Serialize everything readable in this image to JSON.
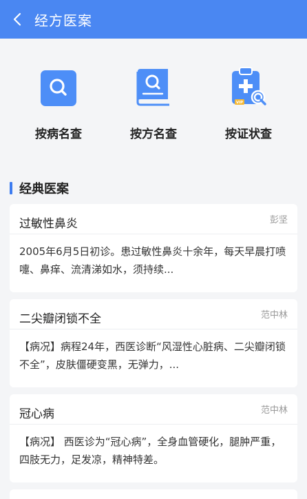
{
  "header": {
    "title": "经方医案"
  },
  "entries": [
    {
      "label": "按病名查",
      "icon": "search-square-icon"
    },
    {
      "label": "按方名查",
      "icon": "book-search-icon"
    },
    {
      "label": "按证状查",
      "icon": "clipboard-plus-search-icon",
      "badge": "VIP"
    }
  ],
  "section": {
    "title": "经典医案"
  },
  "cases": [
    {
      "title": "过敏性鼻炎",
      "author": "彭坚",
      "summary": "2005年6月5日初诊。患过敏性鼻炎十余年，每天早晨打喷嚏、鼻痒、流清涕如水，须持续..."
    },
    {
      "title": "二尖瓣闭锁不全",
      "author": "范中林",
      "summary": "【病况】病程24年，西医诊断“风湿性心脏病、二尖瓣闭锁不全”，皮肤僵硬变黑，无弹力，..."
    },
    {
      "title": "冠心病",
      "author": "范中林",
      "summary": "【病况】 西医诊为“冠心病”，全身血管硬化，腿肿严重，四肢无力，足发凉，精神特差。"
    }
  ],
  "colors": {
    "accent": "#4a87f2",
    "icon_blue": "#4d8ef7",
    "badge_yellow": "#f5b935"
  }
}
